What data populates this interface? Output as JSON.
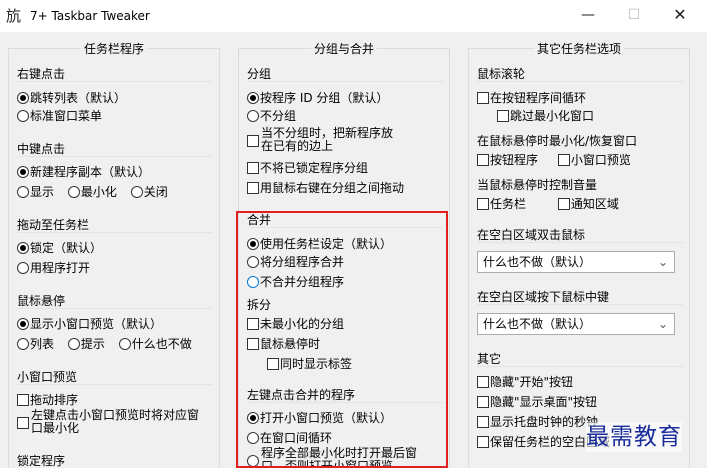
{
  "window": {
    "title": "7+ Taskbar Tweaker",
    "icon": "app-logo-icon",
    "buttons": {
      "minimize": "—",
      "maximize": "☐",
      "close": "✕"
    }
  },
  "left": {
    "title": "任务栏程序",
    "right_click": {
      "title": "右键点击",
      "options": [
        "跳转列表（默认）",
        "标准窗口菜单"
      ],
      "selected": 0
    },
    "middle_click": {
      "title": "中键点击",
      "options": [
        "新建程序副本（默认）",
        "显示",
        "最小化",
        "关闭"
      ],
      "selected": 0
    },
    "drag": {
      "title": "拖动至任务栏",
      "options": [
        "锁定（默认）",
        "用程序打开"
      ],
      "selected": 0
    },
    "hover": {
      "title": "鼠标悬停",
      "options": [
        "显示小窗口预览（默认）",
        "列表",
        "提示",
        "什么也不做"
      ],
      "selected": 0
    },
    "thumbnail": {
      "title": "小窗口预览",
      "checks": [
        "拖动排序",
        "左键点击小窗口预览时将对应窗口最小化"
      ]
    },
    "pinned": {
      "title": "锁定程序"
    }
  },
  "middle": {
    "title": "分组与合并",
    "grouping": {
      "title": "分组",
      "options": [
        "按程序 ID 分组（默认）",
        "不分组"
      ],
      "selected": 0,
      "checks": [
        "当不分组时，把新程序放在已有的边上",
        "不将已锁定程序分组",
        "用鼠标右键在分组之间拖动"
      ]
    },
    "combining": {
      "title": "合并",
      "options": [
        "使用任务栏设定（默认）",
        "将分组程序合并",
        "不合并分组程序"
      ],
      "selected": 0
    },
    "decombine": {
      "title": "拆分",
      "checks": [
        "未最小化的分组",
        "鼠标悬停时",
        "同时显示标签"
      ]
    },
    "left_click_combined": {
      "title": "左键点击合并的程序",
      "options": [
        "打开小窗口预览（默认）",
        "在窗口间循环",
        "程序全部最小化时打开最后窗口，否则打开小窗口预览"
      ],
      "selected": 0
    }
  },
  "right": {
    "title": "其它任务栏选项",
    "wheel": {
      "title": "鼠标滚轮",
      "checks": [
        "在按钮程序间循环",
        "跳过最小化窗口"
      ]
    },
    "hover_minimize": {
      "title": "在鼠标悬停时最小化/恢复窗口",
      "checks": [
        "按钮程序",
        "小窗口预览"
      ]
    },
    "volume": {
      "title": "当鼠标悬停时控制音量",
      "checks": [
        "任务栏",
        "通知区域"
      ]
    },
    "double_click": {
      "title": "在空白区域双击鼠标",
      "value": "什么也不做（默认）"
    },
    "middle_click_empty": {
      "title": "在空白区域按下鼠标中键",
      "value": "什么也不做（默认）"
    },
    "other": {
      "title": "其它",
      "checks": [
        "隐藏\"开始\"按钮",
        "隐藏\"显示桌面\"按钮",
        "显示托盘时钟的秒钟",
        "保留任务栏的空白区域"
      ]
    }
  },
  "watermark": "最需教育"
}
